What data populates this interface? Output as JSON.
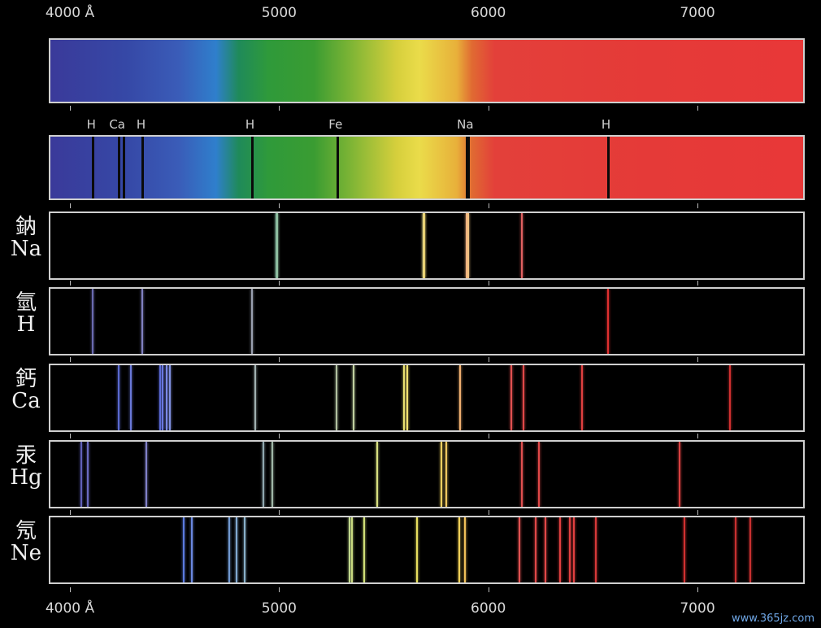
{
  "axis": {
    "top_labels": [
      {
        "text": "4000 Å",
        "wavelength": 4000
      },
      {
        "text": "5000",
        "wavelength": 5000
      },
      {
        "text": "6000",
        "wavelength": 6000
      },
      {
        "text": "7000",
        "wavelength": 7000
      }
    ],
    "bottom_labels": [
      {
        "text": "4000 Å",
        "wavelength": 4000
      },
      {
        "text": "5000",
        "wavelength": 5000
      },
      {
        "text": "6000",
        "wavelength": 6000
      },
      {
        "text": "7000",
        "wavelength": 7000
      }
    ]
  },
  "absorption": {
    "labels": [
      {
        "text": "H",
        "wavelength": 4102
      },
      {
        "text": "Ca",
        "wavelength": 4226
      },
      {
        "text": "H",
        "wavelength": 4340
      },
      {
        "text": "H",
        "wavelength": 4861
      },
      {
        "text": "Fe",
        "wavelength": 5270
      },
      {
        "text": "Na",
        "wavelength": 5890
      },
      {
        "text": "H",
        "wavelength": 6563
      }
    ],
    "lines": [
      4102,
      4226,
      4250,
      4340,
      4861,
      5270,
      5890,
      5896,
      6563
    ]
  },
  "elements": [
    {
      "cjk": "鈉",
      "symbol": "Na",
      "lines": [
        {
          "w": 4979,
          "c": "#7fb3a0"
        },
        {
          "w": 4983,
          "c": "#8fbf9f"
        },
        {
          "w": 5683,
          "c": "#e8e090"
        },
        {
          "w": 5688,
          "c": "#e8d070"
        },
        {
          "w": 5890,
          "c": "#f0b080"
        },
        {
          "w": 5896,
          "c": "#f0c080"
        },
        {
          "w": 6154,
          "c": "#e06060"
        }
      ]
    },
    {
      "cjk": "氫",
      "symbol": "H",
      "lines": [
        {
          "w": 4102,
          "c": "#6a6ab0"
        },
        {
          "w": 4340,
          "c": "#8080c0"
        },
        {
          "w": 4861,
          "c": "#9aa0b0"
        },
        {
          "w": 6563,
          "c": "#e03030"
        }
      ]
    },
    {
      "cjk": "鈣",
      "symbol": "Ca",
      "lines": [
        {
          "w": 4226,
          "c": "#5a6ad0"
        },
        {
          "w": 4283,
          "c": "#6a78d8"
        },
        {
          "w": 4425,
          "c": "#5a6ad8"
        },
        {
          "w": 4435,
          "c": "#6a78e0"
        },
        {
          "w": 4455,
          "c": "#7a88e8"
        },
        {
          "w": 4470,
          "c": "#8090e0"
        },
        {
          "w": 4878,
          "c": "#a0b0b0"
        },
        {
          "w": 5265,
          "c": "#b0c0a0"
        },
        {
          "w": 5350,
          "c": "#c0d0a0"
        },
        {
          "w": 5588,
          "c": "#e8e070"
        },
        {
          "w": 5603,
          "c": "#f0e070"
        },
        {
          "w": 5857,
          "c": "#f0b070"
        },
        {
          "w": 6102,
          "c": "#e05050"
        },
        {
          "w": 6162,
          "c": "#e04848"
        },
        {
          "w": 6439,
          "c": "#e04040"
        },
        {
          "w": 7148,
          "c": "#d03030"
        }
      ]
    },
    {
      "cjk": "汞",
      "symbol": "Hg",
      "lines": [
        {
          "w": 4047,
          "c": "#6060b8"
        },
        {
          "w": 4078,
          "c": "#6a6ac0"
        },
        {
          "w": 4358,
          "c": "#8080c8"
        },
        {
          "w": 4916,
          "c": "#90a8b0"
        },
        {
          "w": 4960,
          "c": "#a0b8a8"
        },
        {
          "w": 5461,
          "c": "#d8e080"
        },
        {
          "w": 5770,
          "c": "#f0d060"
        },
        {
          "w": 5791,
          "c": "#f0c860"
        },
        {
          "w": 6152,
          "c": "#e05050"
        },
        {
          "w": 6234,
          "c": "#e04848"
        },
        {
          "w": 6907,
          "c": "#d84040"
        }
      ]
    },
    {
      "cjk": "氖",
      "symbol": "Ne",
      "lines": [
        {
          "w": 4537,
          "c": "#5a7ae0"
        },
        {
          "w": 4575,
          "c": "#6a88e0"
        },
        {
          "w": 4752,
          "c": "#7098d0"
        },
        {
          "w": 4788,
          "c": "#80a8d0"
        },
        {
          "w": 4827,
          "c": "#88b0c8"
        },
        {
          "w": 5330,
          "c": "#c0d890"
        },
        {
          "w": 5341,
          "c": "#c8d880"
        },
        {
          "w": 5400,
          "c": "#d0e078"
        },
        {
          "w": 5652,
          "c": "#e8e060"
        },
        {
          "w": 5852,
          "c": "#f0d058"
        },
        {
          "w": 5882,
          "c": "#f0c058"
        },
        {
          "w": 6143,
          "c": "#e05050"
        },
        {
          "w": 6217,
          "c": "#e04848"
        },
        {
          "w": 6266,
          "c": "#e04848"
        },
        {
          "w": 6334,
          "c": "#e04040"
        },
        {
          "w": 6383,
          "c": "#e04040"
        },
        {
          "w": 6402,
          "c": "#e04040"
        },
        {
          "w": 6506,
          "c": "#d83838"
        },
        {
          "w": 6929,
          "c": "#d03030"
        },
        {
          "w": 7174,
          "c": "#c83030"
        },
        {
          "w": 7245,
          "c": "#c83030"
        }
      ]
    }
  ],
  "watermark": "www.365jz.com"
}
